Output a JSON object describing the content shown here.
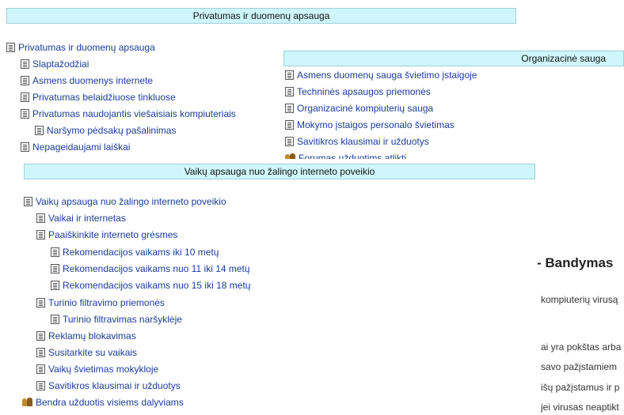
{
  "panel_privacy": {
    "header": "Privatumas ir duomenų apsauga",
    "items": [
      {
        "label": "Privatumas ir duomenų apsauga"
      },
      {
        "label": "Slaptažodžiai"
      },
      {
        "label": "Asmens duomenys internete"
      },
      {
        "label": "Privatumas belaidžiuose tinkluose"
      },
      {
        "label": "Privatumas naudojantis viešaisiais kompiuteriais"
      },
      {
        "label": "Naršymo pėdsakų pašalinimas"
      },
      {
        "label": "Nepageidaujami laiškai"
      }
    ]
  },
  "panel_org": {
    "header": "Organizacinė sauga",
    "items": [
      {
        "label": "Asmens duomenų sauga švietimo įstaigoje"
      },
      {
        "label": "Techninės apsaugos priemonės"
      },
      {
        "label": "Organizacinė kompiuterių sauga"
      },
      {
        "label": "Mokymo įstaigos personalo švietimas"
      },
      {
        "label": "Savitikros klausimai ir užduotys"
      },
      {
        "label": "Forumas užduotims atlikti"
      }
    ]
  },
  "panel_children": {
    "header": "Vaikų apsauga nuo žalingo interneto poveikio",
    "items": [
      {
        "label": "Vaikų apsauga nuo žalingo interneto poveikio"
      },
      {
        "label": "Vaikai ir internetas"
      },
      {
        "label": "Paaiškinkite interneto grėsmes"
      },
      {
        "label": "Rekomendacijos vaikams iki 10 metų"
      },
      {
        "label": "Rekomendacijos vaikams nuo 11 iki 14 metų"
      },
      {
        "label": "Rekomendacijos vaikams nuo 15 iki 18 metų"
      },
      {
        "label": "Turinio filtravimo priemonės"
      },
      {
        "label": "Turinio filtravimas naršyklėje"
      },
      {
        "label": "Reklamų blokavimas"
      },
      {
        "label": "Susitarkite su vaikais"
      },
      {
        "label": "Vaikų švietimas mokykloje"
      },
      {
        "label": "Savitikros klausimai ir užduotys"
      },
      {
        "label": "Bendra užduotis visiems dalyviams"
      }
    ]
  },
  "background_page": {
    "title": "- Bandymas",
    "lines": [
      "kompiuterių virusą",
      "ai yra pokštas arba",
      "savo pažįstamiem",
      "išų pažįstamus ir p",
      "jei virusas neaptikt"
    ]
  },
  "icons": {
    "document": "document-icon",
    "forum": "forum-icon"
  },
  "colors": {
    "header_bg": "#cff7fb",
    "link": "#1a3c9a"
  }
}
